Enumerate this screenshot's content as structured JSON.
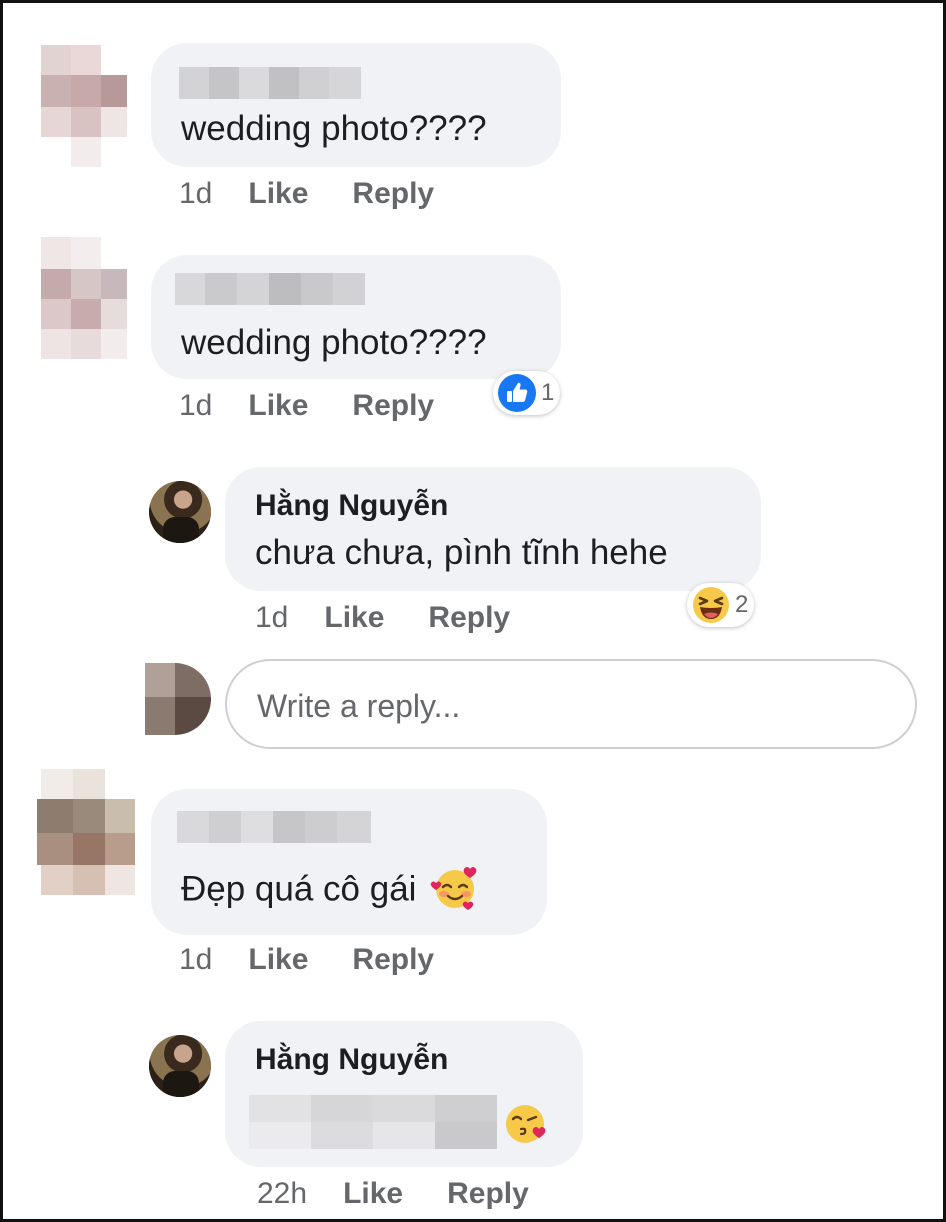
{
  "comments": [
    {
      "text": "wedding photo????",
      "time": "1d",
      "like_label": "Like",
      "reply_label": "Reply"
    },
    {
      "text": "wedding photo????",
      "time": "1d",
      "like_label": "Like",
      "reply_label": "Reply",
      "reaction_count": "1",
      "reaction_icon": "like-icon"
    },
    {
      "author": "Hằng Nguyễn",
      "text": "chưa chưa, pình tĩnh hehe",
      "time": "1d",
      "like_label": "Like",
      "reply_label": "Reply",
      "reaction_count": "2",
      "reaction_icon": "laughing-face-icon"
    },
    {
      "text": "Đẹp quá cô gái",
      "text_emoji": "smiling-face-with-hearts-icon",
      "time": "1d",
      "like_label": "Like",
      "reply_label": "Reply"
    },
    {
      "author": "Hằng Nguyễn",
      "text_emoji": "face-blowing-kiss-icon",
      "time": "22h",
      "like_label": "Like",
      "reply_label": "Reply"
    }
  ],
  "reply_box": {
    "placeholder": "Write a reply..."
  },
  "colors": {
    "bubble": "#f0f2f5",
    "meta_text": "#65676b",
    "like_blue": "#1877f2",
    "emoji_yellow": "#f7c948"
  }
}
